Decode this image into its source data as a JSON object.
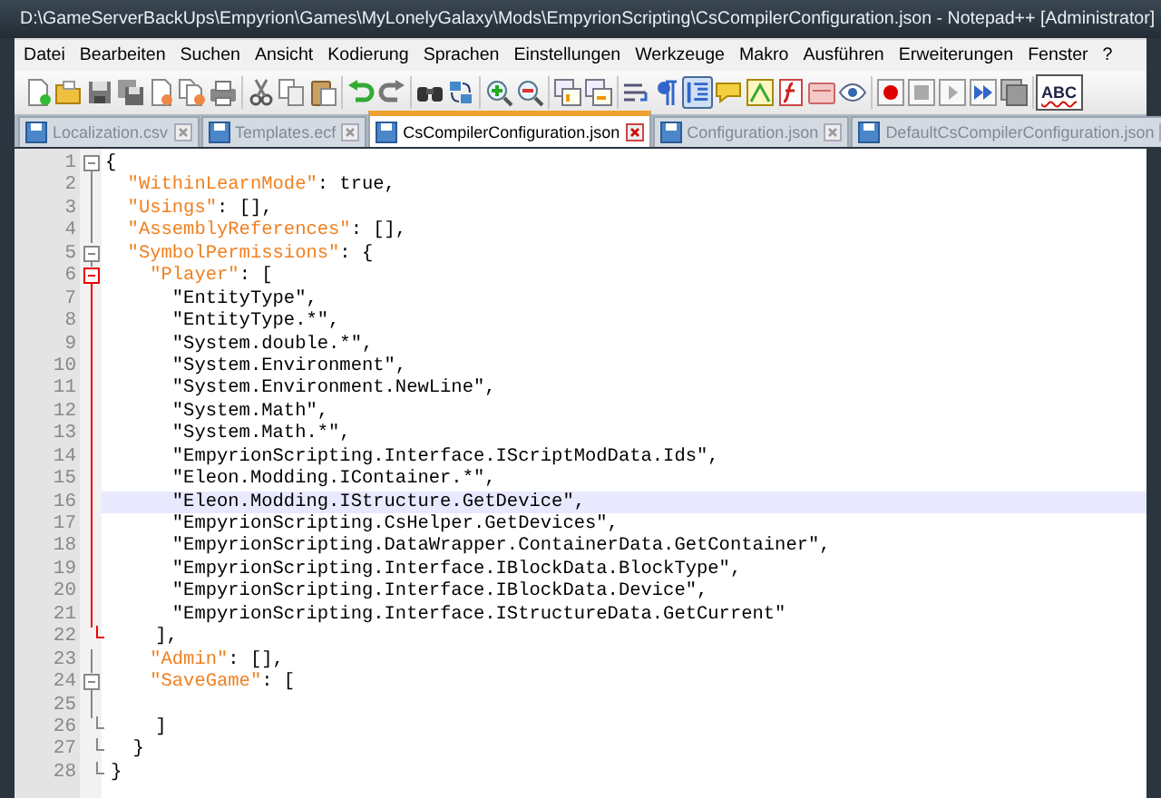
{
  "window": {
    "title": "D:\\GameServerBackUps\\Empyrion\\Games\\MyLonelyGalaxy\\Mods\\EmpyrionScripting\\CsCompilerConfiguration.json - Notepad++ [Administrator]"
  },
  "menu": [
    "Datei",
    "Bearbeiten",
    "Suchen",
    "Ansicht",
    "Kodierung",
    "Sprachen",
    "Einstellungen",
    "Werkzeuge",
    "Makro",
    "Ausführen",
    "Erweiterungen",
    "Fenster",
    "?"
  ],
  "toolbar": [
    {
      "kind": "new",
      "pressed": false
    },
    {
      "kind": "open",
      "pressed": false
    },
    {
      "kind": "save",
      "pressed": false
    },
    {
      "kind": "saveall",
      "pressed": false
    },
    {
      "kind": "close",
      "pressed": false
    },
    {
      "kind": "closeall",
      "pressed": false
    },
    {
      "kind": "print",
      "pressed": false
    },
    {
      "kind": "sep"
    },
    {
      "kind": "cut",
      "pressed": false
    },
    {
      "kind": "copy",
      "pressed": false
    },
    {
      "kind": "paste",
      "pressed": false
    },
    {
      "kind": "sep"
    },
    {
      "kind": "undo",
      "pressed": false
    },
    {
      "kind": "redo",
      "pressed": false
    },
    {
      "kind": "sep"
    },
    {
      "kind": "find",
      "pressed": false
    },
    {
      "kind": "replace",
      "pressed": false
    },
    {
      "kind": "sep"
    },
    {
      "kind": "zoomin",
      "pressed": false
    },
    {
      "kind": "zoomout",
      "pressed": false
    },
    {
      "kind": "sep"
    },
    {
      "kind": "syncv",
      "pressed": false
    },
    {
      "kind": "synch",
      "pressed": false
    },
    {
      "kind": "sep"
    },
    {
      "kind": "wrap",
      "pressed": false
    },
    {
      "kind": "allchars",
      "pressed": false
    },
    {
      "kind": "indent",
      "pressed": true
    },
    {
      "kind": "lang",
      "pressed": false
    },
    {
      "kind": "docmap",
      "pressed": false
    },
    {
      "kind": "func",
      "pressed": false
    },
    {
      "kind": "folder",
      "pressed": false
    },
    {
      "kind": "monitor",
      "pressed": false
    },
    {
      "kind": "sep"
    },
    {
      "kind": "record",
      "pressed": false
    },
    {
      "kind": "stop",
      "pressed": false
    },
    {
      "kind": "play",
      "pressed": false
    },
    {
      "kind": "playmulti",
      "pressed": false
    },
    {
      "kind": "saverec",
      "pressed": false
    },
    {
      "kind": "sep"
    },
    {
      "kind": "spell",
      "pressed": false,
      "label": "ABC"
    }
  ],
  "tabs": [
    {
      "label": "Localization.csv",
      "selected": false
    },
    {
      "label": "Templates.ecf",
      "selected": false
    },
    {
      "label": "CsCompilerConfiguration.json",
      "selected": true
    },
    {
      "label": "Configuration.json",
      "selected": false
    },
    {
      "label": "DefaultCsCompilerConfiguration.json",
      "selected": false
    }
  ],
  "editor": {
    "lines": [
      {
        "number": "1",
        "kind": "box",
        "active": false,
        "current": false,
        "tokens": [
          {
            "kind": "punct",
            "text": "{"
          }
        ]
      },
      {
        "number": "2",
        "kind": "line",
        "active": false,
        "current": false,
        "tokens": [
          {
            "kind": "key",
            "text": "  \"WithinLearnMode\""
          },
          {
            "kind": "punct",
            "text": ": true,"
          }
        ]
      },
      {
        "number": "3",
        "kind": "line",
        "active": false,
        "current": false,
        "tokens": [
          {
            "kind": "key",
            "text": "  \"Usings\""
          },
          {
            "kind": "punct",
            "text": ": [],"
          }
        ]
      },
      {
        "number": "4",
        "kind": "line",
        "active": false,
        "current": false,
        "tokens": [
          {
            "kind": "key",
            "text": "  \"AssemblyReferences\""
          },
          {
            "kind": "punct",
            "text": ": [],"
          }
        ]
      },
      {
        "number": "5",
        "kind": "box",
        "active": false,
        "current": false,
        "tokens": [
          {
            "kind": "key",
            "text": "  \"SymbolPermissions\""
          },
          {
            "kind": "punct",
            "text": ": {"
          }
        ]
      },
      {
        "number": "6",
        "kind": "box",
        "active": true,
        "current": false,
        "tokens": [
          {
            "kind": "key",
            "text": "    \"Player\""
          },
          {
            "kind": "punct",
            "text": ": ["
          }
        ]
      },
      {
        "number": "7",
        "kind": "line",
        "active": true,
        "current": false,
        "tokens": [
          {
            "kind": "string",
            "text": "      \"EntityType\","
          }
        ]
      },
      {
        "number": "8",
        "kind": "line",
        "active": true,
        "current": false,
        "tokens": [
          {
            "kind": "string",
            "text": "      \"EntityType.*\","
          }
        ]
      },
      {
        "number": "9",
        "kind": "line",
        "active": true,
        "current": false,
        "tokens": [
          {
            "kind": "string",
            "text": "      \"System.double.*\","
          }
        ]
      },
      {
        "number": "10",
        "kind": "line",
        "active": true,
        "current": false,
        "tokens": [
          {
            "kind": "string",
            "text": "      \"System.Environment\","
          }
        ]
      },
      {
        "number": "11",
        "kind": "line",
        "active": true,
        "current": false,
        "tokens": [
          {
            "kind": "string",
            "text": "      \"System.Environment.NewLine\","
          }
        ]
      },
      {
        "number": "12",
        "kind": "line",
        "active": true,
        "current": false,
        "tokens": [
          {
            "kind": "string",
            "text": "      \"System.Math\","
          }
        ]
      },
      {
        "number": "13",
        "kind": "line",
        "active": true,
        "current": false,
        "tokens": [
          {
            "kind": "string",
            "text": "      \"System.Math.*\","
          }
        ]
      },
      {
        "number": "14",
        "kind": "line",
        "active": true,
        "current": false,
        "tokens": [
          {
            "kind": "string",
            "text": "      \"EmpyrionScripting.Interface.IScriptModData.Ids\","
          }
        ]
      },
      {
        "number": "15",
        "kind": "line",
        "active": true,
        "current": false,
        "tokens": [
          {
            "kind": "string",
            "text": "      \"Eleon.Modding.IContainer.*\","
          }
        ]
      },
      {
        "number": "16",
        "kind": "line",
        "active": true,
        "current": true,
        "tokens": [
          {
            "kind": "string",
            "text": "      \"Eleon.Modding.IStructure.GetDevice\","
          }
        ]
      },
      {
        "number": "17",
        "kind": "line",
        "active": true,
        "current": false,
        "tokens": [
          {
            "kind": "string",
            "text": "      \"EmpyrionScripting.CsHelper.GetDevices\","
          }
        ]
      },
      {
        "number": "18",
        "kind": "line",
        "active": true,
        "current": false,
        "tokens": [
          {
            "kind": "string",
            "text": "      \"EmpyrionScripting.DataWrapper.ContainerData.GetContainer\","
          }
        ]
      },
      {
        "number": "19",
        "kind": "line",
        "active": true,
        "current": false,
        "tokens": [
          {
            "kind": "string",
            "text": "      \"EmpyrionScripting.Interface.IBlockData.BlockType\","
          }
        ]
      },
      {
        "number": "20",
        "kind": "line",
        "active": true,
        "current": false,
        "tokens": [
          {
            "kind": "string",
            "text": "      \"EmpyrionScripting.Interface.IBlockData.Device\","
          }
        ]
      },
      {
        "number": "21",
        "kind": "line",
        "active": true,
        "current": false,
        "tokens": [
          {
            "kind": "string",
            "text": "      \"EmpyrionScripting.Interface.IStructureData.GetCurrent\""
          }
        ]
      },
      {
        "number": "22",
        "kind": "end",
        "active": true,
        "current": false,
        "tokens": [
          {
            "kind": "punct",
            "text": "    ],"
          }
        ]
      },
      {
        "number": "23",
        "kind": "line",
        "active": false,
        "current": false,
        "tokens": [
          {
            "kind": "key",
            "text": "    \"Admin\""
          },
          {
            "kind": "punct",
            "text": ": [],"
          }
        ]
      },
      {
        "number": "24",
        "kind": "box",
        "active": false,
        "current": false,
        "tokens": [
          {
            "kind": "key",
            "text": "    \"SaveGame\""
          },
          {
            "kind": "punct",
            "text": ": ["
          }
        ]
      },
      {
        "number": "25",
        "kind": "line",
        "active": false,
        "current": false
      },
      {
        "number": "26",
        "kind": "end",
        "active": false,
        "current": false,
        "tokens": [
          {
            "kind": "punct",
            "text": "    ]"
          }
        ]
      },
      {
        "number": "27",
        "kind": "end",
        "active": false,
        "current": false,
        "tokens": [
          {
            "kind": "punct",
            "text": "  }"
          }
        ]
      },
      {
        "number": "28",
        "kind": "end",
        "active": false,
        "current": false,
        "tokens": [
          {
            "kind": "punct",
            "text": "}"
          }
        ]
      }
    ]
  }
}
